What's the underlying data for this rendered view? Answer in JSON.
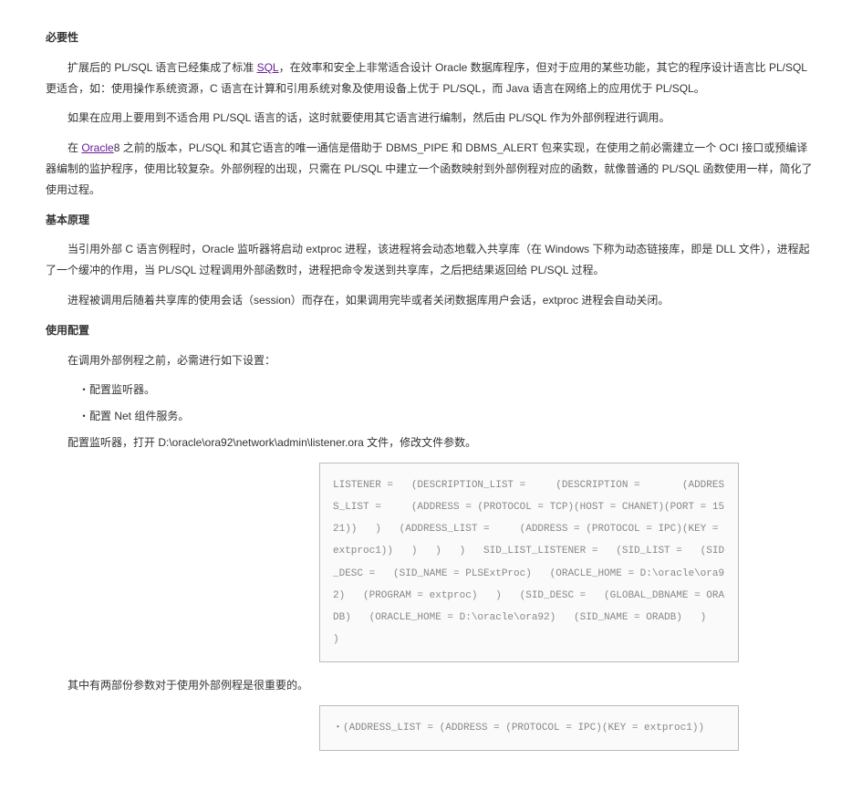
{
  "headings": {
    "h1": "必要性",
    "h2": "基本原理",
    "h3": "使用配置"
  },
  "links": {
    "sql": "SQL",
    "oracle": "Oracle"
  },
  "paragraphs": {
    "p1_a": "扩展后的 PL/SQL 语言已经集成了标准 ",
    "p1_b": "，在效率和安全上非常适合设计 Oracle 数据库程序，但对于应用的某些功能，其它的程序设计语言比 PL/SQL 更适合，如：使用操作系统资源，C 语言在计算和引用系统对象及使用设备上优于 PL/SQL，而 Java 语言在网络上的应用优于 PL/SQL。",
    "p2": "如果在应用上要用到不适合用 PL/SQL 语言的话，这时就要使用其它语言进行编制，然后由 PL/SQL 作为外部例程进行调用。",
    "p3_a": "在 ",
    "p3_b": "8 之前的版本，PL/SQL 和其它语言的唯一通信是借助于 DBMS_PIPE 和 DBMS_ALERT 包来实现，在使用之前必需建立一个 OCI 接口或预编译器编制的监护程序，使用比较复杂。外部例程的出现，只需在 PL/SQL 中建立一个函数映射到外部例程对应的函数，就像普通的 PL/SQL 函数使用一样，简化了使用过程。",
    "p4": "当引用外部 C 语言例程时，Oracle 监听器将启动 extproc 进程，该进程将会动态地载入共享库（在 Windows 下称为动态链接库，即是 DLL 文件），进程起了一个缓冲的作用，当 PL/SQL 过程调用外部函数时，进程把命令发送到共享库，之后把结果返回给 PL/SQL 过程。",
    "p5": "进程被调用后随着共享库的使用会话（session）而存在，如果调用完毕或者关闭数据库用户会话，extproc 进程会自动关闭。",
    "p6": "在调用外部例程之前，必需进行如下设置：",
    "b1": "・配置监听器。",
    "b2": "・配置 Net 组件服务。",
    "p7": "配置监听器，打开 D:\\oracle\\ora92\\network\\admin\\listener.ora 文件，修改文件参数。",
    "p8": "其中有两部份参数对于使用外部例程是很重要的。"
  },
  "code": {
    "block1": "LISTENER =   (DESCRIPTION_LIST =     (DESCRIPTION =       (ADDRESS_LIST =     (ADDRESS = (PROTOCOL = TCP)(HOST = CHANET)(PORT = 1521))   )   (ADDRESS_LIST =     (ADDRESS = (PROTOCOL = IPC)(KEY = extproc1))   )   )   )   SID_LIST_LISTENER =   (SID_LIST =   (SID_DESC =   (SID_NAME = PLSExtProc)   (ORACLE_HOME = D:\\oracle\\ora92)   (PROGRAM = extproc)   )   (SID_DESC =   (GLOBAL_DBNAME = ORADB)   (ORACLE_HOME = D:\\oracle\\ora92)   (SID_NAME = ORADB)   )   )",
    "block2": "・(ADDRESS_LIST = (ADDRESS = (PROTOCOL = IPC)(KEY = extproc1))"
  }
}
